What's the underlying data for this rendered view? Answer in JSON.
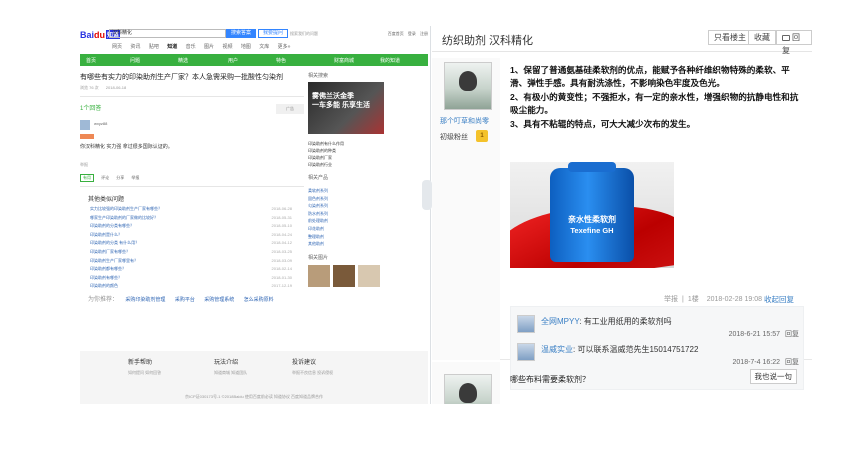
{
  "left_panel": {
    "logo_text_a": "Bai",
    "logo_text_b": "du",
    "logo_suffix": "知道",
    "search_value": "汉科精化",
    "search_button": "搜索答案",
    "ask_button": "我要提问",
    "top_hint": "搜索我们的问题",
    "top_right": [
      "百度首页",
      "登录",
      "注册"
    ],
    "tabs": [
      "网页",
      "资讯",
      "贴吧",
      "知道",
      "音乐",
      "图片",
      "视频",
      "地图",
      "文库",
      "更多»"
    ],
    "active_tab": "知道",
    "nav": [
      "首页",
      "问题",
      "精选",
      "用户",
      "特色",
      "财富商城",
      "我的知道"
    ],
    "question_title": "有哪些有实力的印染助剂生产厂家？本人急需采购一批酸性匀染剂",
    "question_meta": [
      "浏览 76 次",
      "2018-06-18"
    ],
    "ad_label": "广告",
    "answer_count": "1个回答",
    "answerer": "wxyz88",
    "answer_text": "你汉科精化 实力强 拿过很多国际认证的。",
    "report_text": "举报",
    "answer_actions": [
      "有用",
      "评论",
      "分享",
      "举报"
    ],
    "answer_ok": "有用",
    "related_title": "其他类似问题",
    "related": [
      {
        "q": "实力比较强的印染助剂生产厂家有哪些？",
        "d": "2018-06-28"
      },
      {
        "q": "哪家生产印染助剂的厂家做的比较好？",
        "d": "2018-05-31"
      },
      {
        "q": "印染助剂的分类有哪些？",
        "d": "2018-05-10"
      },
      {
        "q": "印染助剂是什么？",
        "d": "2018-04-24"
      },
      {
        "q": "印染助剂的分类 有什么用？",
        "d": "2018-04-12"
      },
      {
        "q": "印染助剂厂家有哪些？",
        "d": "2018-03-25"
      },
      {
        "q": "印染助剂生产厂家哪里有？",
        "d": "2018-03-09"
      },
      {
        "q": "印染助剂都有哪些？",
        "d": "2018-02-14"
      },
      {
        "q": "印染助剂有哪些？",
        "d": "2018-01-30"
      },
      {
        "q": "印染助剂的颜色",
        "d": "2017-12-19"
      },
      {
        "q": "印染助剂的销售渠道有哪些？",
        "d": "2017-11-28"
      }
    ],
    "more_label": "为你推荐：",
    "more_links": [
      "采购印染助剂管理",
      "采购平台",
      "采购管理系统",
      "怎么采购原料"
    ],
    "right_title": "相关搜索",
    "banner_line1": "雾佛兰沃金季",
    "banner_line2": "一车多能 乐享生活",
    "right_links": [
      "印染助剂有什么作用",
      "印染助剂的种类",
      "印染助剂厂家",
      "印染助剂行业"
    ],
    "hot_title": "相关产品",
    "hot_items": [
      "柔软剂系列",
      "固色剂系列",
      "匀染剂系列",
      "防水剂系列",
      "前处理助剂",
      "印花助剂",
      "整理助剂",
      "其他助剂"
    ],
    "thumbs_title": "相关图片",
    "footer": [
      {
        "title": "新手帮助",
        "sub": "如何提问  如何回答"
      },
      {
        "title": "玩法介绍",
        "sub": "知道商城  知道团队"
      },
      {
        "title": "投诉建议",
        "sub": "举报不良信息  投诉侵权"
      }
    ],
    "copyright": "京ICP证030173号-1  ©2018Baidu  使用百度前必读  知道协议  百度知道品牌合作"
  },
  "right_panel": {
    "header_title": "纺织助剂 汉科精化",
    "btn_owner_only": "只看楼主",
    "btn_favorite": "收藏",
    "btn_reply": "回复",
    "post": {
      "username": "那个叮草和尚零",
      "rank": "初级粉丝",
      "rank_level": "1",
      "lines": [
        "1、保留了普通氨基硅柔软剂的优点，能赋予各种纤维织物特殊的柔软、平滑、弹性手感。具有耐洗涤性，不影响染色牢度及色光。",
        "2、有极小的黄变性；不强拒水，有一定的亲水性，增强织物的抗静电性和抗吸尘能力。",
        "3、具有不粘辊的特点，可大大减少次布的发生。"
      ],
      "product_label_1": "亲水性柔软剂",
      "product_label_2": "Texefine GH",
      "report": "举报",
      "floor": "1楼",
      "date": "2018-02-28 19:08",
      "reply_link": "收起回复",
      "replies": [
        {
          "name": "全网MPYY",
          "text": "有工业用纸用的柔软剂吗",
          "date": "2018-6-21 15:57",
          "action": "回复"
        },
        {
          "name": "温威实业",
          "text": "可以联系温威范先生15014751722",
          "date": "2018-7-4 16:22",
          "action": "回复"
        }
      ],
      "say_button": "我也说一句"
    },
    "post2_text": "哪些布料需要柔软剂？"
  }
}
